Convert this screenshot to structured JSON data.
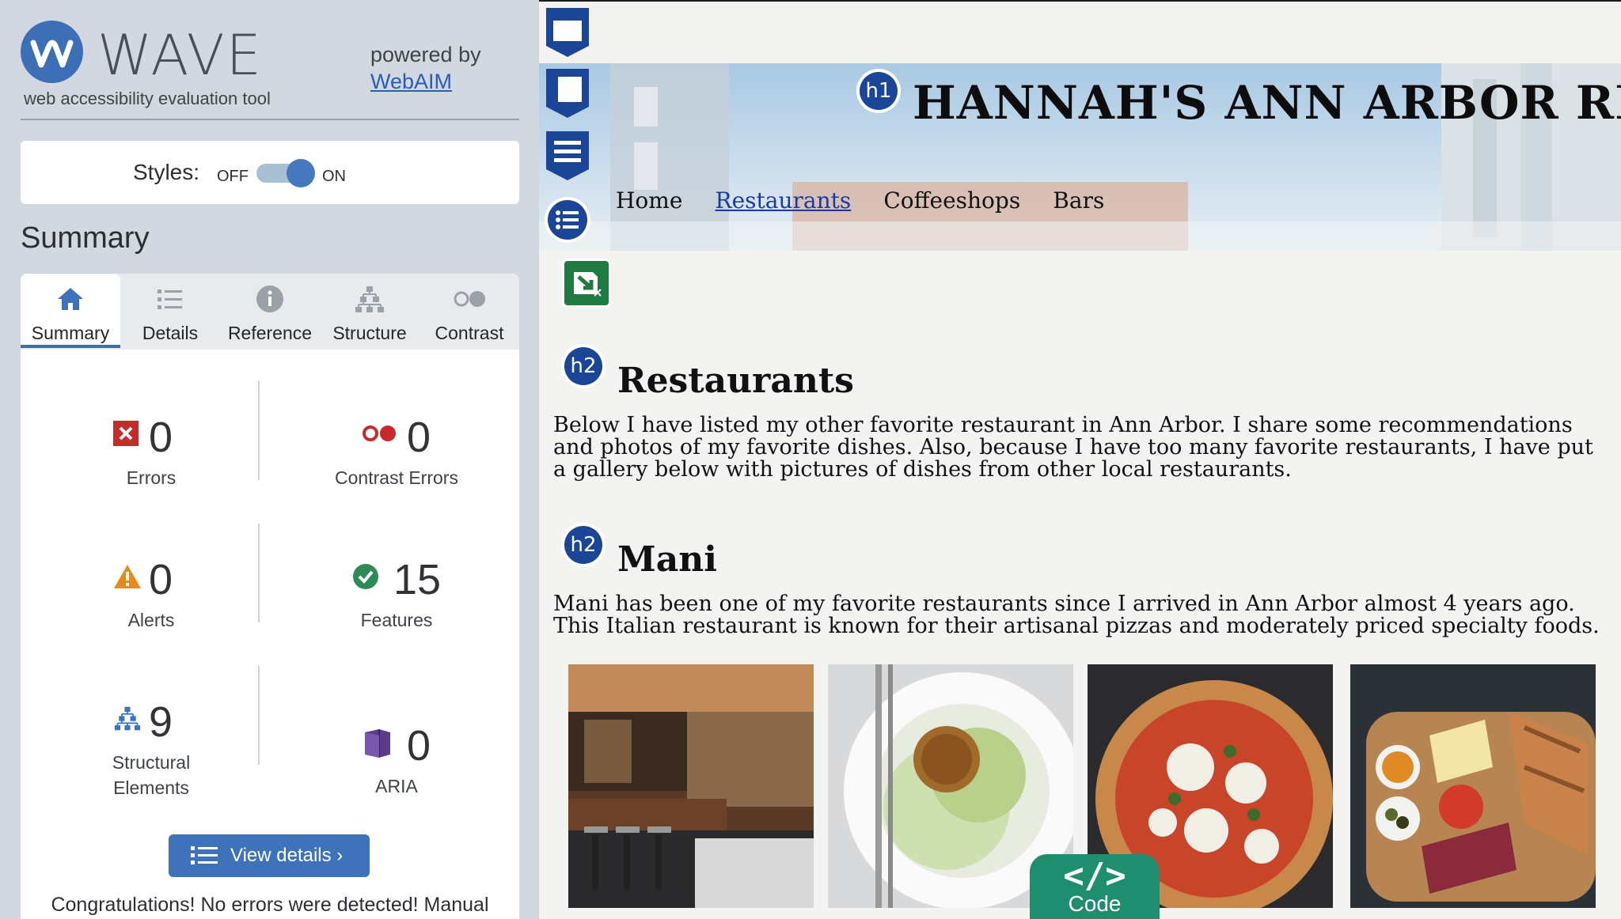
{
  "wave": {
    "title": "WAVE",
    "subtitle": "web accessibility evaluation tool",
    "powered_by": "powered by",
    "webaim_link": "WebAIM",
    "styles_label": "Styles:",
    "styles_off": "OFF",
    "styles_on": "ON",
    "styles_state": "on",
    "summary_heading": "Summary",
    "tabs": [
      {
        "label": "Summary",
        "icon": "home-icon",
        "active": true
      },
      {
        "label": "Details",
        "icon": "list-icon",
        "active": false
      },
      {
        "label": "Reference",
        "icon": "info-icon",
        "active": false
      },
      {
        "label": "Structure",
        "icon": "structure-icon",
        "active": false
      },
      {
        "label": "Contrast",
        "icon": "contrast-icon",
        "active": false
      }
    ],
    "stats": {
      "errors": {
        "value": "0",
        "label": "Errors",
        "color": "#c52b2b"
      },
      "contrast_errors": {
        "value": "0",
        "label": "Contrast Errors",
        "color": "#c52b2b"
      },
      "alerts": {
        "value": "0",
        "label": "Alerts",
        "color": "#e8891c"
      },
      "features": {
        "value": "15",
        "label": "Features",
        "color": "#2e8b57"
      },
      "structural": {
        "value": "9",
        "label_line1": "Structural",
        "label_line2": "Elements",
        "color": "#3e73bb"
      },
      "aria": {
        "value": "0",
        "label": "ARIA",
        "color": "#5b3b8c"
      }
    },
    "view_details": "View details ›",
    "congrats": "Congratulations! No errors were detected! Manual"
  },
  "site": {
    "title": "HANNAH'S ANN ARBOR REVIEW",
    "nav": [
      "Home",
      "Restaurants",
      "Coffeeshops",
      "Bars"
    ],
    "current_nav": "Restaurants",
    "h1_badge": "h1",
    "h2_badge": "h2",
    "section1": {
      "heading": "Restaurants",
      "text": "Below I have listed my other favorite restaurant in Ann Arbor. I share some recommendations and photos of my favorite dishes. Also, because I have too many favorite restaurants, I have put a gallery below with pictures of dishes from other local restaurants."
    },
    "section2": {
      "heading": "Mani",
      "text": "Mani has been one of my favorite restaurants since I arrived in Ann Arbor almost 4 years ago. This Italian restaurant is known for their artisanal pizzas and moderately priced specialty foods."
    },
    "photos": [
      "restaurant-interior",
      "salad-dish",
      "pizza",
      "charcuterie-board"
    ],
    "code_glyph": "</>",
    "code_label": "Code",
    "accent": "#1b4596",
    "code_tab_color": "#1f8e6e"
  }
}
